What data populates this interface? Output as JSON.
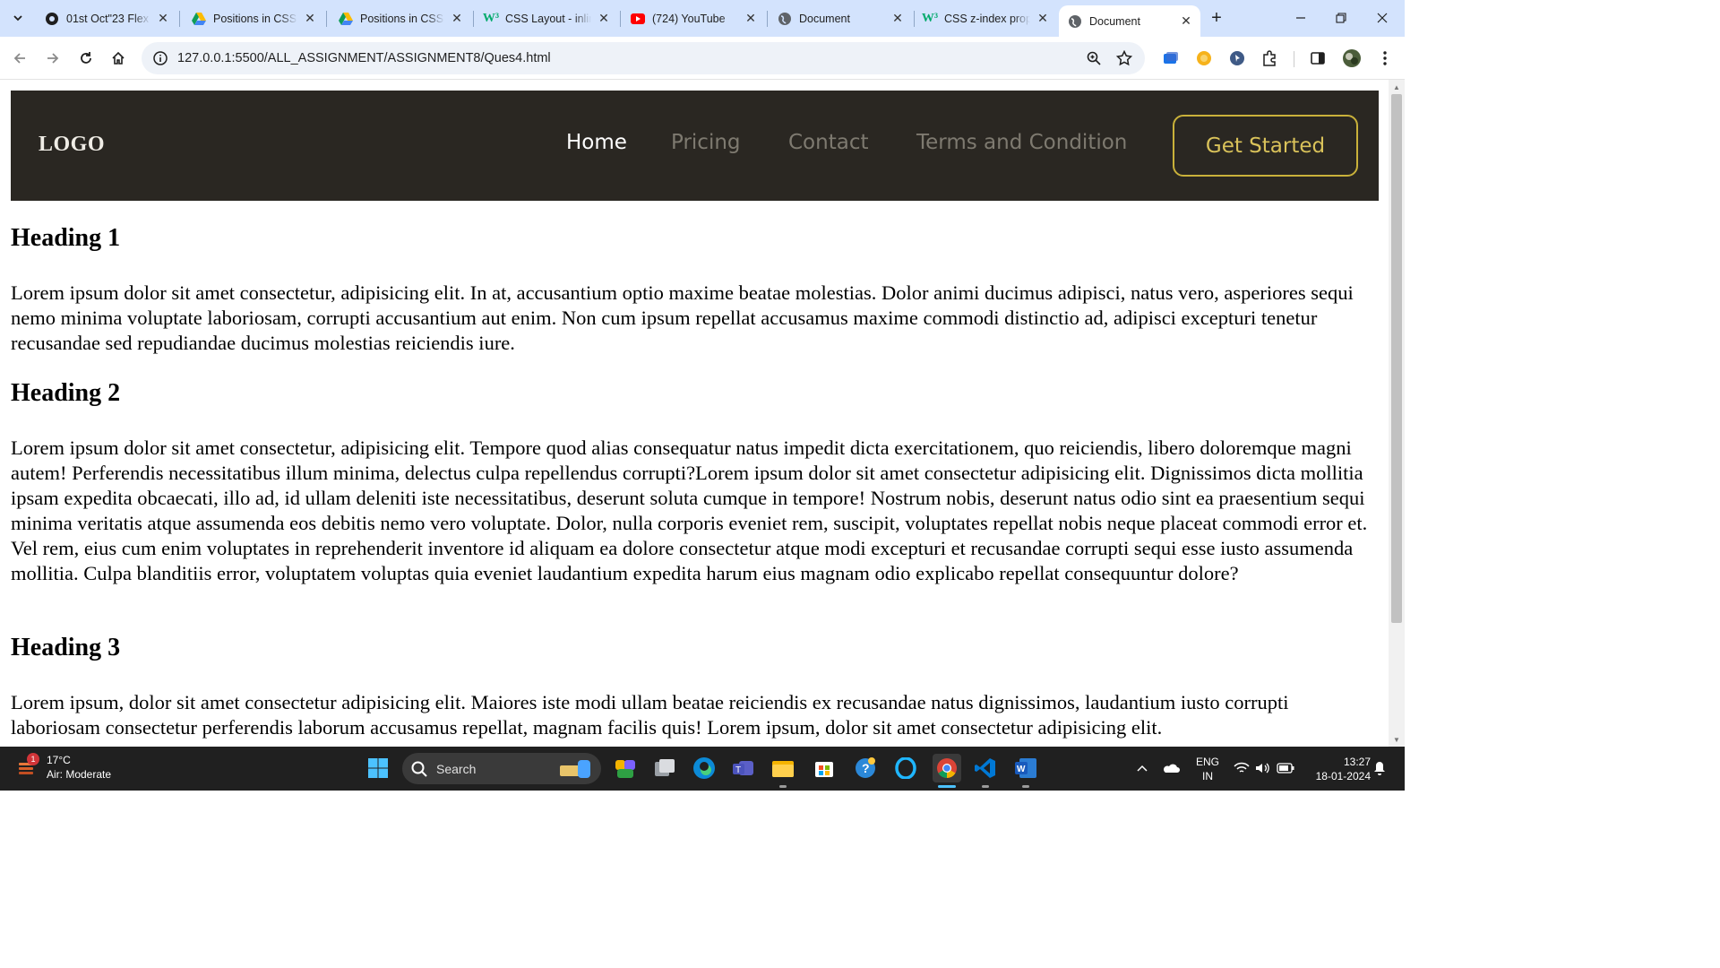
{
  "browser": {
    "tabs": [
      {
        "title": "01st Oct\"23 Flex",
        "icon": "web-icon"
      },
      {
        "title": "Positions in CSS",
        "icon": "google-drive-icon"
      },
      {
        "title": "Positions in CSS",
        "icon": "google-drive-icon"
      },
      {
        "title": "CSS Layout - inline",
        "icon": "w3schools-icon"
      },
      {
        "title": "(724) YouTube",
        "icon": "youtube-icon"
      },
      {
        "title": "Document",
        "icon": "globe-icon"
      },
      {
        "title": "CSS z-index prop",
        "icon": "w3schools-icon"
      },
      {
        "title": "Document",
        "icon": "globe-icon",
        "active": true
      }
    ],
    "url": "127.0.0.1:5500/ALL_ASSIGNMENT/ASSIGNMENT8/Ques4.html"
  },
  "page": {
    "logo": "LOGO",
    "nav": [
      {
        "label": "Home",
        "active": true
      },
      {
        "label": "Pricing"
      },
      {
        "label": "Contact"
      },
      {
        "label": "Terms and Condition"
      }
    ],
    "cta_label": "Get Started",
    "colors": {
      "nav_bg": "#2a2722",
      "cta": "#d9c25a",
      "nav_link": "#7e7a70",
      "nav_active": "#ffffff"
    },
    "sections": [
      {
        "heading": "Heading 1",
        "text": "Lorem ipsum dolor sit amet consectetur, adipisicing elit. In at, accusantium optio maxime beatae molestias. Dolor animi ducimus adipisci, natus vero, asperiores sequi nemo minima voluptate laboriosam, corrupti accusantium aut enim. Non cum ipsum repellat accusamus maxime commodi distinctio ad, adipisci excepturi tenetur recusandae sed repudiandae ducimus molestias reiciendis iure."
      },
      {
        "heading": "Heading 2",
        "text": "Lorem ipsum dolor sit amet consectetur, adipisicing elit. Tempore quod alias consequatur natus impedit dicta exercitationem, quo reiciendis, libero doloremque magni autem! Perferendis necessitatibus illum minima, delectus culpa repellendus corrupti?Lorem ipsum dolor sit amet consectetur adipisicing elit. Dignissimos dicta mollitia ipsam expedita obcaecati, illo ad, id ullam deleniti iste necessitatibus, deserunt soluta cumque in tempore! Nostrum nobis, deserunt natus odio sint ea praesentium sequi minima veritatis atque assumenda eos debitis nemo vero voluptate. Dolor, nulla corporis eveniet rem, suscipit, voluptates repellat nobis neque placeat commodi error et. Vel rem, eius cum enim voluptates in reprehenderit inventore id aliquam ea dolore consectetur atque modi excepturi et recusandae corrupti sequi esse iusto assumenda mollitia. Culpa blanditiis error, voluptatem voluptas quia eveniet laudantium expedita harum eius magnam odio explicabo repellat consequuntur dolore?"
      },
      {
        "heading": "Heading 3",
        "text": "Lorem ipsum, dolor sit amet consectetur adipisicing elit. Maiores iste modi ullam beatae reiciendis ex recusandae natus dignissimos, laudantium iusto corrupti laboriosam consectetur perferendis laborum accusamus repellat, magnam facilis quis! Lorem ipsum, dolor sit amet consectetur adipisicing elit."
      }
    ]
  },
  "taskbar": {
    "weather_temp": "17°C",
    "weather_desc": "Air: Moderate",
    "weather_badge": "1",
    "search_label": "Search",
    "lang_1": "ENG",
    "lang_2": "IN",
    "time": "13:27",
    "date": "18-01-2024"
  }
}
